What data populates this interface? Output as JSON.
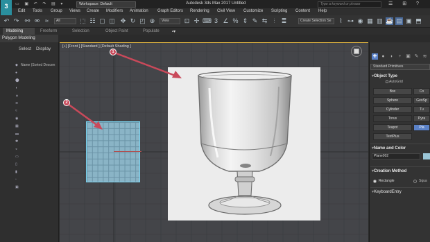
{
  "title_bar": {
    "logo": "3",
    "workspace": "Workspace: Default",
    "title": "Autodesk 3ds Max 2017    Untitled",
    "search_placeholder": "Type a keyword or phrase"
  },
  "menu": [
    "Edit",
    "Tools",
    "Group",
    "Views",
    "Create",
    "Modifiers",
    "Animation",
    "Graph Editors",
    "Rendering",
    "Civil View",
    "Customize",
    "Scripting",
    "Content",
    "Help"
  ],
  "toolbar": {
    "filter_dropdown": "All",
    "view_dropdown": "View",
    "selection_set": "Create Selection Se"
  },
  "ribbon": {
    "tabs": [
      "Modeling",
      "Freeform",
      "Selection",
      "Object Paint",
      "Populate"
    ],
    "sub_label": "Polygon Modeling"
  },
  "explorer": {
    "select": "Select",
    "display": "Display",
    "column": "Name (Sorted Descen"
  },
  "viewport": {
    "label": "[+] [Front ] [Standard ] [Default Shading ]"
  },
  "badges": [
    "1",
    "2"
  ],
  "command_panel": {
    "category": "Standard Primitives",
    "object_type": "Object Type",
    "autogrid": "AutoGrid",
    "buttons": [
      "Box",
      "Co",
      "Sphere",
      "GeoSp",
      "Cylinder",
      "Tu",
      "Torus",
      "Pyra",
      "Teapot",
      "Pla",
      "TextPlus"
    ],
    "name_and_color": "Name and Color",
    "object_name": "Plane002",
    "creation_method": "Creation Method",
    "rectangle": "Rectangle",
    "square": "Squa",
    "keyboard_entry": "KeyboardEntry"
  },
  "colors": {
    "accent_blue": "#5b82c8",
    "arrow_red": "#c9495a",
    "plane_fill": "#8ab4c6"
  }
}
